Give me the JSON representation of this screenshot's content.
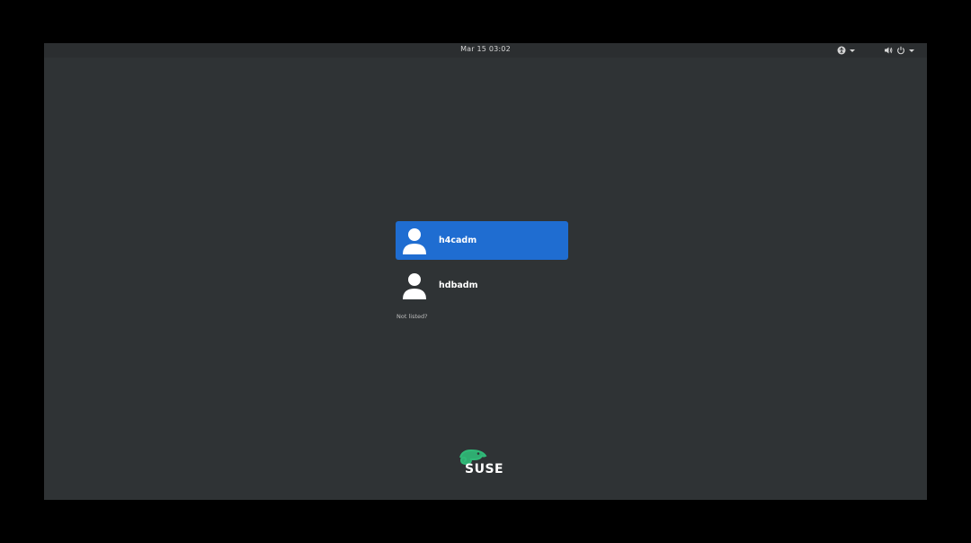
{
  "topbar": {
    "clock": "Mar 15  03:02",
    "icons": [
      "accessibility-icon",
      "volume-icon",
      "power-icon"
    ]
  },
  "users": [
    {
      "name": "h4cadm",
      "selected": true
    },
    {
      "name": "hdbadm",
      "selected": false
    }
  ],
  "not_listed_label": "Not listed?",
  "branding": {
    "logo_text": "SUSE",
    "logo_color": "#30ba78"
  },
  "colors": {
    "background": "#2f3335",
    "selection": "#1f6dd1",
    "text": "#ffffff"
  }
}
